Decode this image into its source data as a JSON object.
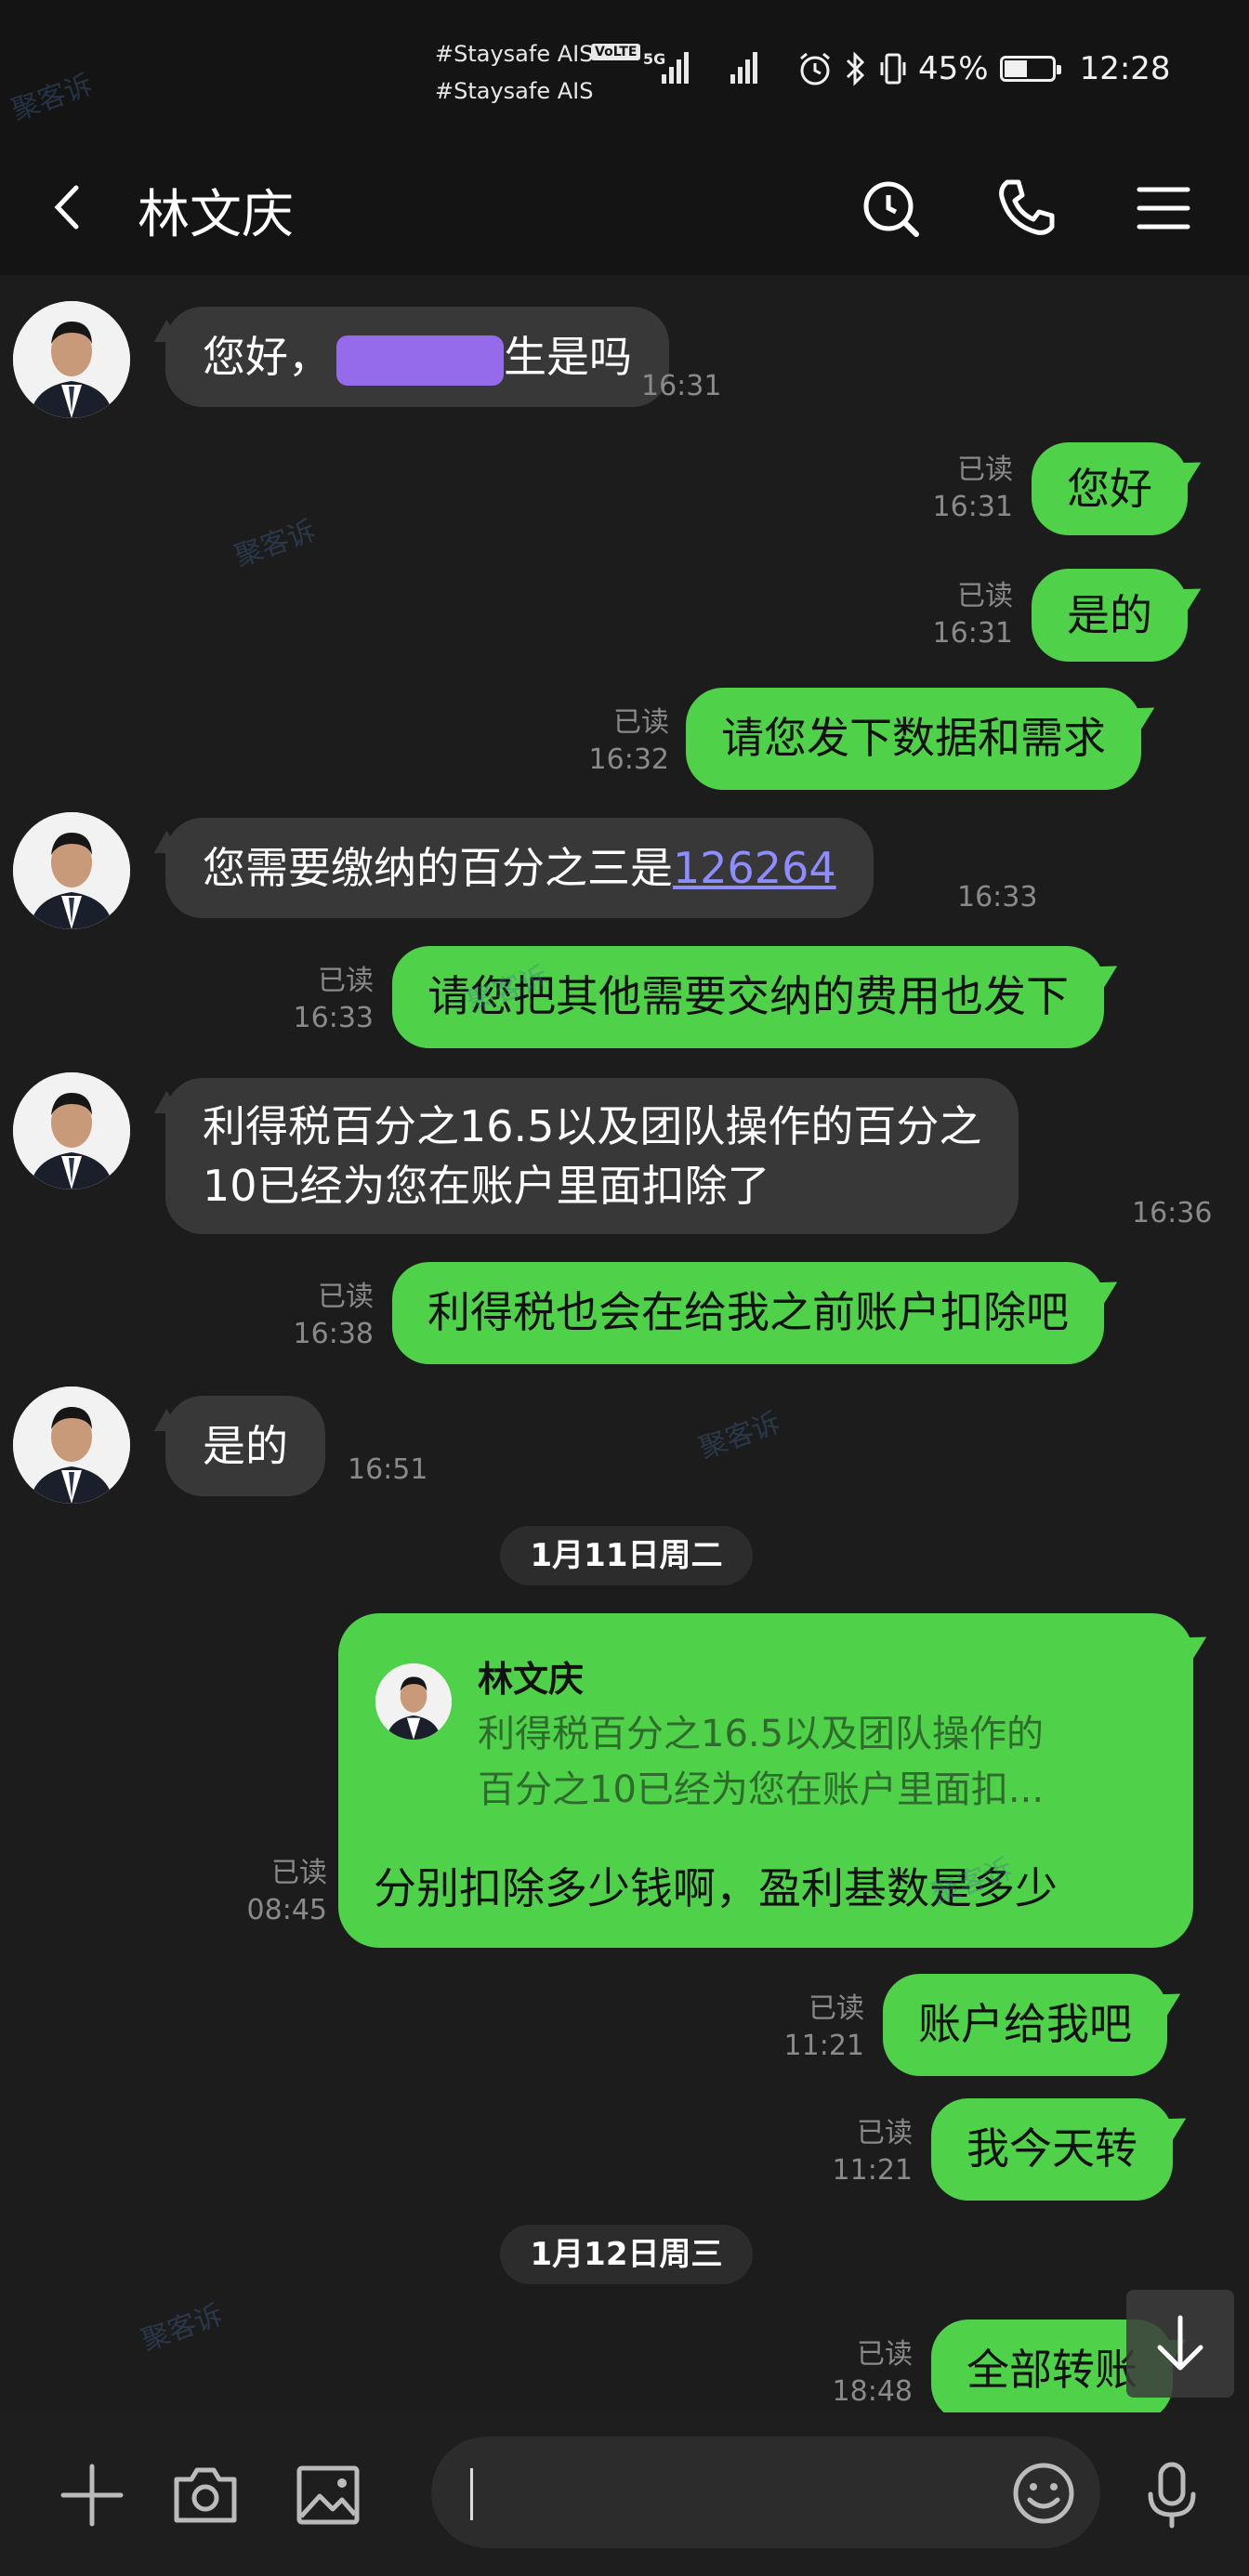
{
  "status_bar": {
    "carrier_1": "#Staysafe AIS",
    "volte": "VoLTE",
    "carrier_2": "#Staysafe AIS",
    "network": "5G",
    "battery": "45%",
    "time": "12:28"
  },
  "header": {
    "title": "林文庆",
    "icons": [
      "back-icon",
      "search-icon",
      "phone-icon",
      "menu-icon"
    ]
  },
  "messages": [
    {
      "dir": "in",
      "text": "您好，",
      "text_after": "生是吗",
      "time": "16:31"
    },
    {
      "dir": "out",
      "text": "您好",
      "read": "已读",
      "time": "16:31"
    },
    {
      "dir": "out",
      "text": "是的",
      "read": "已读",
      "time": "16:31"
    },
    {
      "dir": "out",
      "text": "请您发下数据和需求",
      "read": "已读",
      "time": "16:32"
    },
    {
      "dir": "in",
      "text": "您需要缴纳的百分之三是",
      "link": "126264",
      "time": "16:33"
    },
    {
      "dir": "out",
      "text": "请您把其他需要交纳的费用也发下",
      "read": "已读",
      "time": "16:33"
    },
    {
      "dir": "in",
      "line1": "利得税百分之16.5以及团队操作的百分之",
      "line2": "10已经为您在账户里面扣除了",
      "time": "16:36"
    },
    {
      "dir": "out",
      "text": "利得税也会在给我之前账户扣除吧",
      "read": "已读",
      "time": "16:38"
    },
    {
      "dir": "in",
      "text": "是的",
      "time": "16:51"
    },
    {
      "date": "1月11日周二"
    },
    {
      "dir": "out",
      "quote_name": "林文庆",
      "quote_line1": "利得税百分之16.5以及团队操作的",
      "quote_line2": "百分之10已经为您在账户里面扣...",
      "text": "分别扣除多少钱啊，盈利基数是多少",
      "read": "已读",
      "time": "08:45"
    },
    {
      "dir": "out",
      "text": "账户给我吧",
      "read": "已读",
      "time": "11:21"
    },
    {
      "dir": "out",
      "text": "我今天转",
      "read": "已读",
      "time": "11:21"
    },
    {
      "date": "1月12日周三"
    },
    {
      "dir": "out",
      "text": "全部转账",
      "read": "已读",
      "time": "18:48"
    }
  ],
  "input_bar": {
    "icons": [
      "plus-icon",
      "camera-icon",
      "image-icon",
      "emoji-icon",
      "microphone-icon"
    ],
    "input_value": ""
  },
  "watermark": "聚客诉",
  "colors": {
    "background": "#1c1c1c",
    "incoming_bubble": "#383838",
    "outgoing_bubble": "#4fd14a",
    "link": "#8e8cff"
  }
}
